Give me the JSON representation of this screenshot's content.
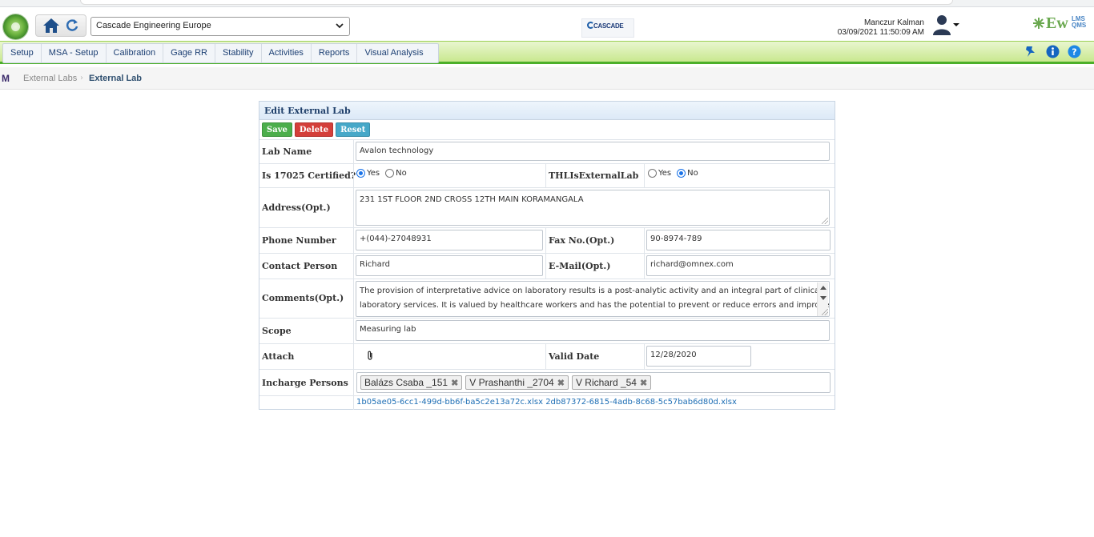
{
  "header": {
    "company": "Cascade Engineering Europe",
    "partner_logo_text": "CASCADE",
    "user_name": "Manczur Kalman",
    "datetime": "03/09/2021 11:50:09 AM",
    "brand_text": "Ew",
    "brand_sup": "LMS QMS",
    "icons": [
      "home-icon",
      "refresh-icon",
      "user-avatar-icon",
      "pin-icon",
      "info-icon",
      "help-icon"
    ]
  },
  "nav": {
    "items": [
      "Setup",
      "MSA - Setup",
      "Calibration",
      "Gage RR",
      "Stability",
      "Activities",
      "Reports",
      "Visual Analysis"
    ]
  },
  "breadcrumb": {
    "root": "M",
    "items": [
      "External Labs",
      "External Lab"
    ]
  },
  "form": {
    "title": "Edit External Lab",
    "buttons": {
      "save": "Save",
      "delete": "Delete",
      "reset": "Reset"
    },
    "lab_name": {
      "label": "Lab Name",
      "value": "Avalon technology"
    },
    "certified": {
      "label": "Is 17025 Certified?",
      "yes": "Yes",
      "no": "No",
      "selected": "Yes"
    },
    "thl_external": {
      "label": "THLIsExternalLab",
      "yes": "Yes",
      "no": "No",
      "selected": "No"
    },
    "address": {
      "label": "Address(Opt.)",
      "value": "231 1ST FLOOR 2ND CROSS 12TH MAIN KORAMANGALA"
    },
    "phone": {
      "label": "Phone Number",
      "value": "+(044)-27048931"
    },
    "fax": {
      "label": "Fax No.(Opt.)",
      "value": "90-8974-789"
    },
    "contact": {
      "label": "Contact Person",
      "value": "Richard"
    },
    "email": {
      "label": "E-Mail(Opt.)",
      "value": "richard@omnex.com"
    },
    "comments": {
      "label": "Comments(Opt.)",
      "line1": "The provision of interpretative advice on laboratory results is a post-analytic activity and an integral part of clinical",
      "line2": "laboratory services. It is valued by healthcare workers and has the potential to prevent or reduce errors and improve"
    },
    "scope": {
      "label": "Scope",
      "value": "Measuring lab"
    },
    "attach": {
      "label": "Attach"
    },
    "valid_date": {
      "label": "Valid Date",
      "value": "12/28/2020"
    },
    "incharge": {
      "label": "Incharge Persons",
      "persons": [
        "Balázs Csaba _151",
        "V Prashanthi _2704",
        "V Richard _54"
      ]
    },
    "files": [
      "1b05ae05-6cc1-499d-bb6f-ba5c2e13a72c.xlsx",
      "2db87372-6815-4adb-8c68-5c57bab6d80d.xlsx"
    ]
  },
  "colors": {
    "nav_green": "#c9e88f",
    "nav_border": "#4caf2a",
    "save": "#4cae4c",
    "delete": "#d43f3a",
    "reset": "#46a8c8",
    "link": "#1f6fb5"
  }
}
